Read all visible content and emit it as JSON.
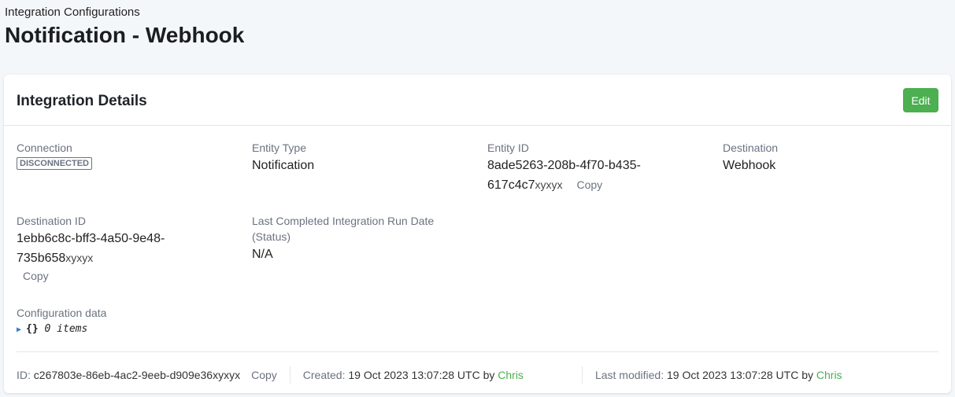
{
  "header": {
    "breadcrumb": "Integration Configurations",
    "title": "Notification - Webhook"
  },
  "card": {
    "title": "Integration Details",
    "edit_label": "Edit"
  },
  "fields": {
    "connection": {
      "label": "Connection",
      "status": "DISCONNECTED"
    },
    "entity_type": {
      "label": "Entity Type",
      "value": "Notification"
    },
    "entity_id": {
      "label": "Entity ID",
      "value": "8ade5263-208b-4f70-b435-617c4c7",
      "suffix": "xyxyx",
      "copy": "Copy"
    },
    "destination": {
      "label": "Destination",
      "value": "Webhook"
    },
    "destination_id": {
      "label": "Destination ID",
      "value": "1ebb6c8c-bff3-4a50-9e48-735b658",
      "suffix": "xyxyx",
      "copy": "Copy"
    },
    "last_run": {
      "label": "Last Completed Integration Run Date (Status)",
      "value": "N/A"
    },
    "config": {
      "label": "Configuration data",
      "braces": "{}",
      "items": "0 items"
    }
  },
  "footer": {
    "id_label": "ID:",
    "id_value": "c267803e-86eb-4ac2-9eeb-d909e36xyxyx",
    "copy": "Copy",
    "created_label": "Created:",
    "created_value": "19 Oct 2023 13:07:28 UTC by",
    "created_by": "Chris",
    "modified_label": "Last modified:",
    "modified_value": "19 Oct 2023 13:07:28 UTC by",
    "modified_by": "Chris"
  }
}
